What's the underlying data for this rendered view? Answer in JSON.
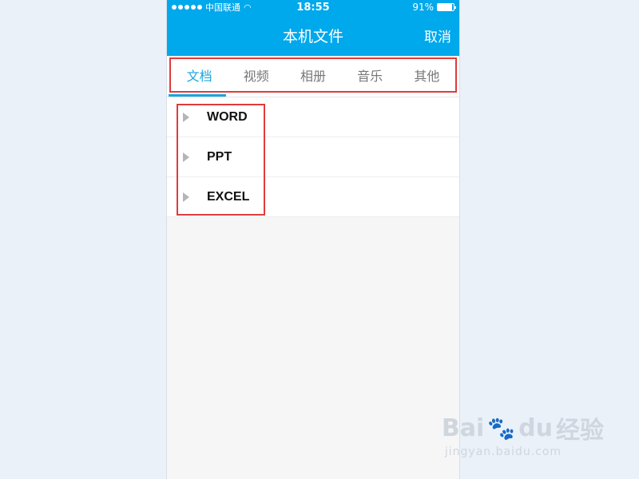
{
  "status": {
    "carrier": "中国联通",
    "time": "18:55",
    "battery": "91%",
    "battery_level": 0.91
  },
  "nav": {
    "title": "本机文件",
    "cancel": "取消"
  },
  "tabs": [
    {
      "label": "文档",
      "active": true
    },
    {
      "label": "视频"
    },
    {
      "label": "相册"
    },
    {
      "label": "音乐"
    },
    {
      "label": "其他"
    }
  ],
  "items": [
    {
      "label": "WORD"
    },
    {
      "label": "PPT"
    },
    {
      "label": "EXCEL"
    }
  ],
  "watermark": {
    "brand_left": "Bai",
    "brand_paw": "du",
    "brand_right": "经验",
    "url": "jingyan.baidu.com"
  },
  "colors": {
    "accent": "#00a8ec",
    "highlight": "#e03b3b",
    "tab_active": "#1aa6df"
  }
}
